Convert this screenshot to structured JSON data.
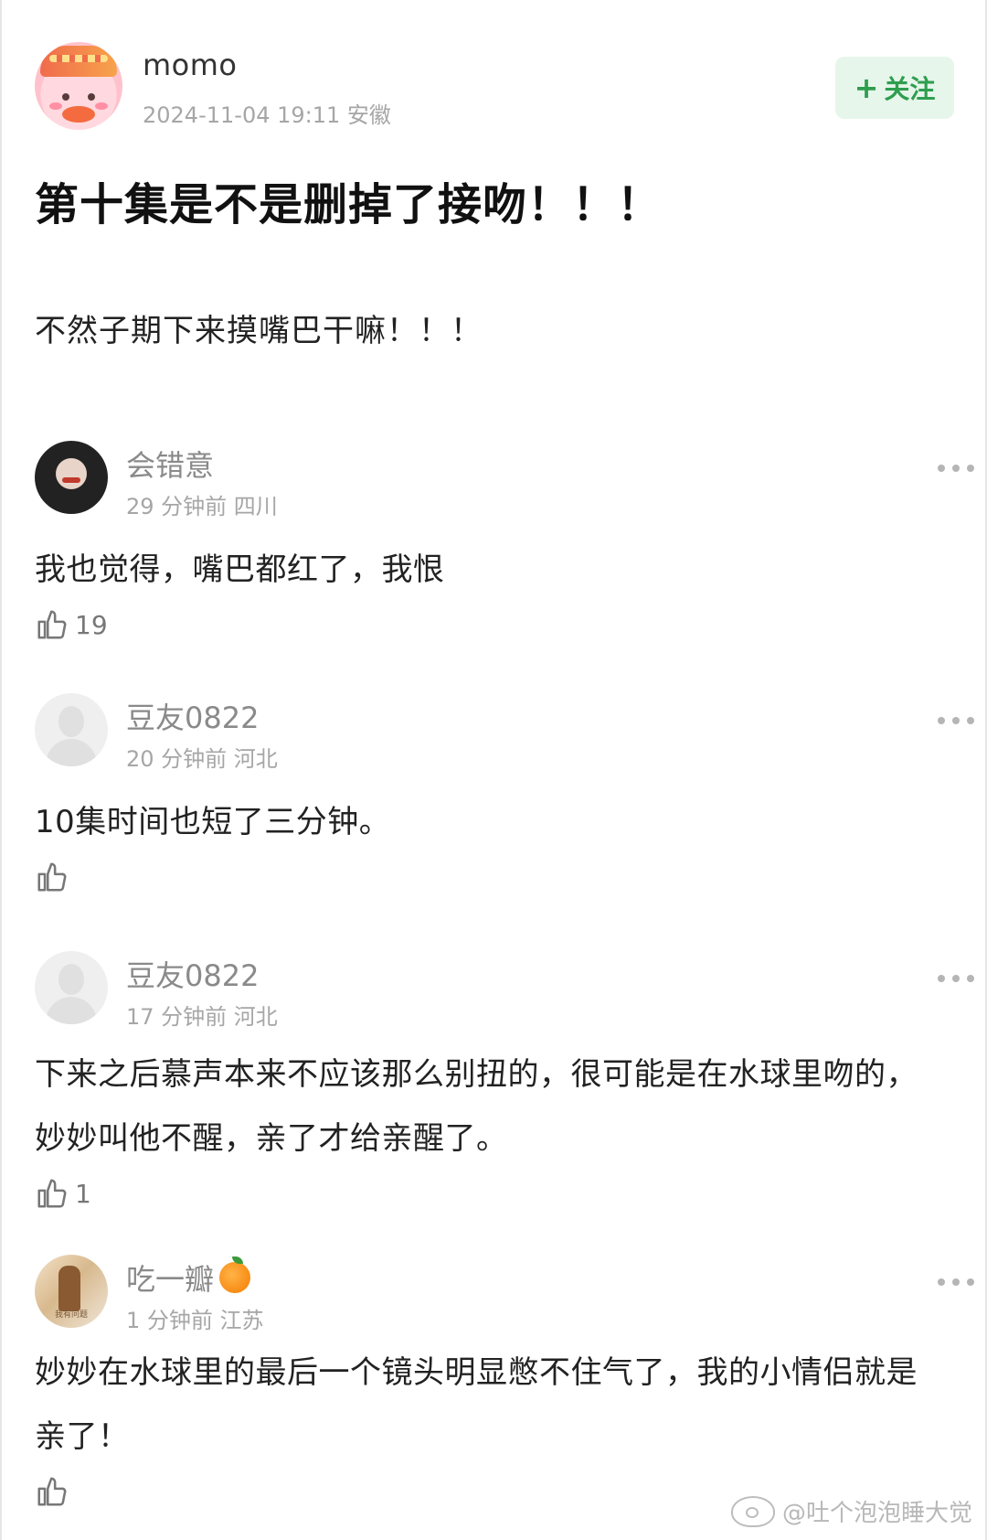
{
  "post": {
    "author": "momo",
    "meta": "2024-11-04 19:11  安徽",
    "follow_label": "关注",
    "title": "第十集是不是删掉了接吻！！！",
    "body": "不然子期下来摸嘴巴干嘛！！！"
  },
  "comments": [
    {
      "name": "会错意",
      "meta": "29 分钟前  四川",
      "text": "我也觉得，嘴巴都红了，我恨",
      "likes": "19"
    },
    {
      "name": "豆友0822",
      "meta": "20 分钟前  河北",
      "text": "10集时间也短了三分钟。",
      "likes": ""
    },
    {
      "name": "豆友0822",
      "meta": "17 分钟前  河北",
      "text": "下来之后慕声本来不应该那么别扭的，很可能是在水球里吻的，妙妙叫他不醒，亲了才给亲醒了。",
      "likes": "1"
    },
    {
      "name": "吃一瓣",
      "meta": "1 分钟前  江苏",
      "text": "妙妙在水球里的最后一个镜头明显憋不住气了，我的小情侣就是亲了！",
      "likes": "",
      "avatar_text": "我有问题"
    }
  ],
  "watermark": "@吐个泡泡睡大觉",
  "icons": {
    "like": "thumbs-up-icon",
    "more": "more-dots-icon",
    "follow": "plus-icon",
    "emoji": "orange-icon"
  },
  "colors": {
    "follow_bg": "#e6f6ea",
    "follow_text": "#2e9e4f",
    "meta_gray": "#a6a6a6"
  }
}
